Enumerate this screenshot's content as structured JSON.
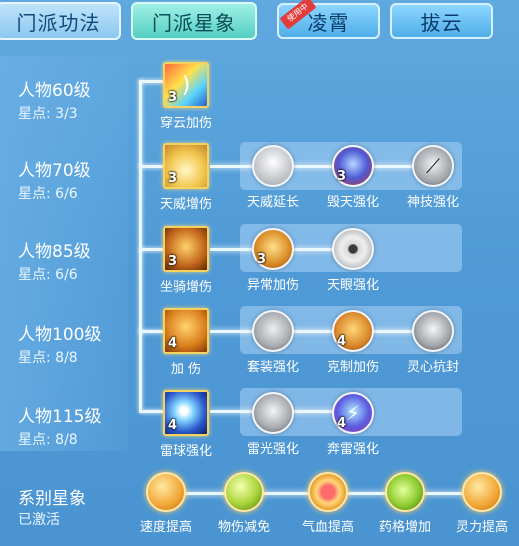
{
  "tabs": {
    "menpai_gongfa": "门派功法",
    "menpai_xingxiang": "门派星象",
    "lingxiao": "凌霄",
    "bayun": "拔云",
    "in_use_ribbon": "使用中"
  },
  "levels": [
    {
      "title": "人物60级",
      "stars": "星点: 3/3"
    },
    {
      "title": "人物70级",
      "stars": "星点: 6/6"
    },
    {
      "title": "人物85级",
      "stars": "星点: 6/6"
    },
    {
      "title": "人物100级",
      "stars": "星点: 8/8"
    },
    {
      "title": "人物115级",
      "stars": "星点: 8/8"
    }
  ],
  "rows": [
    {
      "main": {
        "label": "穿云加伤",
        "count": "3"
      },
      "subs": []
    },
    {
      "main": {
        "label": "天威增伤",
        "count": "3"
      },
      "subs": [
        {
          "label": "天威延长",
          "count": ""
        },
        {
          "label": "毁天强化",
          "count": "3"
        },
        {
          "label": "神技强化",
          "count": ""
        }
      ]
    },
    {
      "main": {
        "label": "坐骑增伤",
        "count": "3"
      },
      "subs": [
        {
          "label": "异常加伤",
          "count": "3"
        },
        {
          "label": "天眼强化",
          "count": ""
        }
      ]
    },
    {
      "main": {
        "label": "加 伤",
        "count": "4"
      },
      "subs": [
        {
          "label": "套装强化",
          "count": ""
        },
        {
          "label": "克制加伤",
          "count": "4"
        },
        {
          "label": "灵心抗封",
          "count": ""
        }
      ]
    },
    {
      "main": {
        "label": "雷球强化",
        "count": "4"
      },
      "subs": [
        {
          "label": "雷光强化",
          "count": ""
        },
        {
          "label": "奔雷强化",
          "count": "4"
        }
      ]
    }
  ],
  "bottom": {
    "title": "系别星象",
    "status": "已激活",
    "items": [
      "速度提高",
      "物伤减免",
      "气血提高",
      "药格增加",
      "灵力提高"
    ]
  },
  "colors": {
    "accent": "#f6d35e",
    "bg": "#4f9ad6",
    "tab_active": "#55cfc3"
  }
}
